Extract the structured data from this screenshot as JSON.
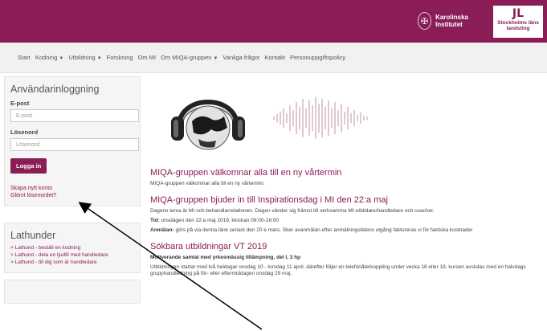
{
  "header": {
    "logo_ki": "Karolinska Institutet",
    "logo_sll": "Stockholms läns landsting"
  },
  "nav": {
    "items": [
      {
        "label": "Start",
        "dropdown": false
      },
      {
        "label": "Kodning",
        "dropdown": true
      },
      {
        "label": "Utbildning",
        "dropdown": true
      },
      {
        "label": "Forskning",
        "dropdown": false
      },
      {
        "label": "Om MI",
        "dropdown": false
      },
      {
        "label": "Om MIQA-gruppen",
        "dropdown": true
      },
      {
        "label": "Vanliga frågor",
        "dropdown": false
      },
      {
        "label": "Kontakt",
        "dropdown": false
      },
      {
        "label": "Personuppgiftspolicy",
        "dropdown": false
      }
    ]
  },
  "login": {
    "title": "Användarinloggning",
    "email_label": "E-post",
    "email_placeholder": "E-post",
    "password_label": "Lösenord",
    "password_placeholder": "Lösenord",
    "login_button": "Logga in",
    "create_account": "Skapa nytt konto",
    "forgot_password": "Glömt lösenordet?"
  },
  "lathunder": {
    "title": "Lathunder",
    "items": [
      "> Lathund - beställ en kodning",
      "> Lathund - dela en ljudfil med handledare",
      "> Lathund - till dig som är handledare"
    ]
  },
  "posts": [
    {
      "title": "MIQA-gruppen välkomnar alla till en ny vårtermin",
      "text": "MIQA-gruppen välkomnar alla till en ny vårtermin."
    },
    {
      "title": "MIQA-gruppen bjuder in till Inspirationsdag i MI den 22:a maj",
      "text": "Dagens tema är MI och behandlarrelationen. Dagen vänder sig främst till verksamma MI-utbildare/handledare och coacher.",
      "time_label": "Tid:",
      "time_text": "onsdagen den 22:a maj 2019, klockan 09:00-16:00",
      "signup_label": "Anmälan:",
      "signup_text": "görs på via denna länk senast den 20 e mars. Sker avanmälan efter anmälningstidens utgång faktureras vi för faktiska kostnader"
    },
    {
      "title": "Sökbara utbildningar VT 2019",
      "subtitle": "Motiverande samtal med yrkesmässig tillämpning, del I, 3 hp",
      "text": "Utbildningen startar med två heldagar onsdag 10 - torsdag 11 april, därefter följer en telefonåterkoppling under vecka 18 eller 19, kursen avslutas med en halvdags grupphandledning på för- eller eftermiddagen onsdag 29 maj."
    }
  ],
  "colors": {
    "brand": "#8a1c56",
    "nav_bg": "#f1f1f1",
    "panel_bg": "#f5f5f5"
  }
}
